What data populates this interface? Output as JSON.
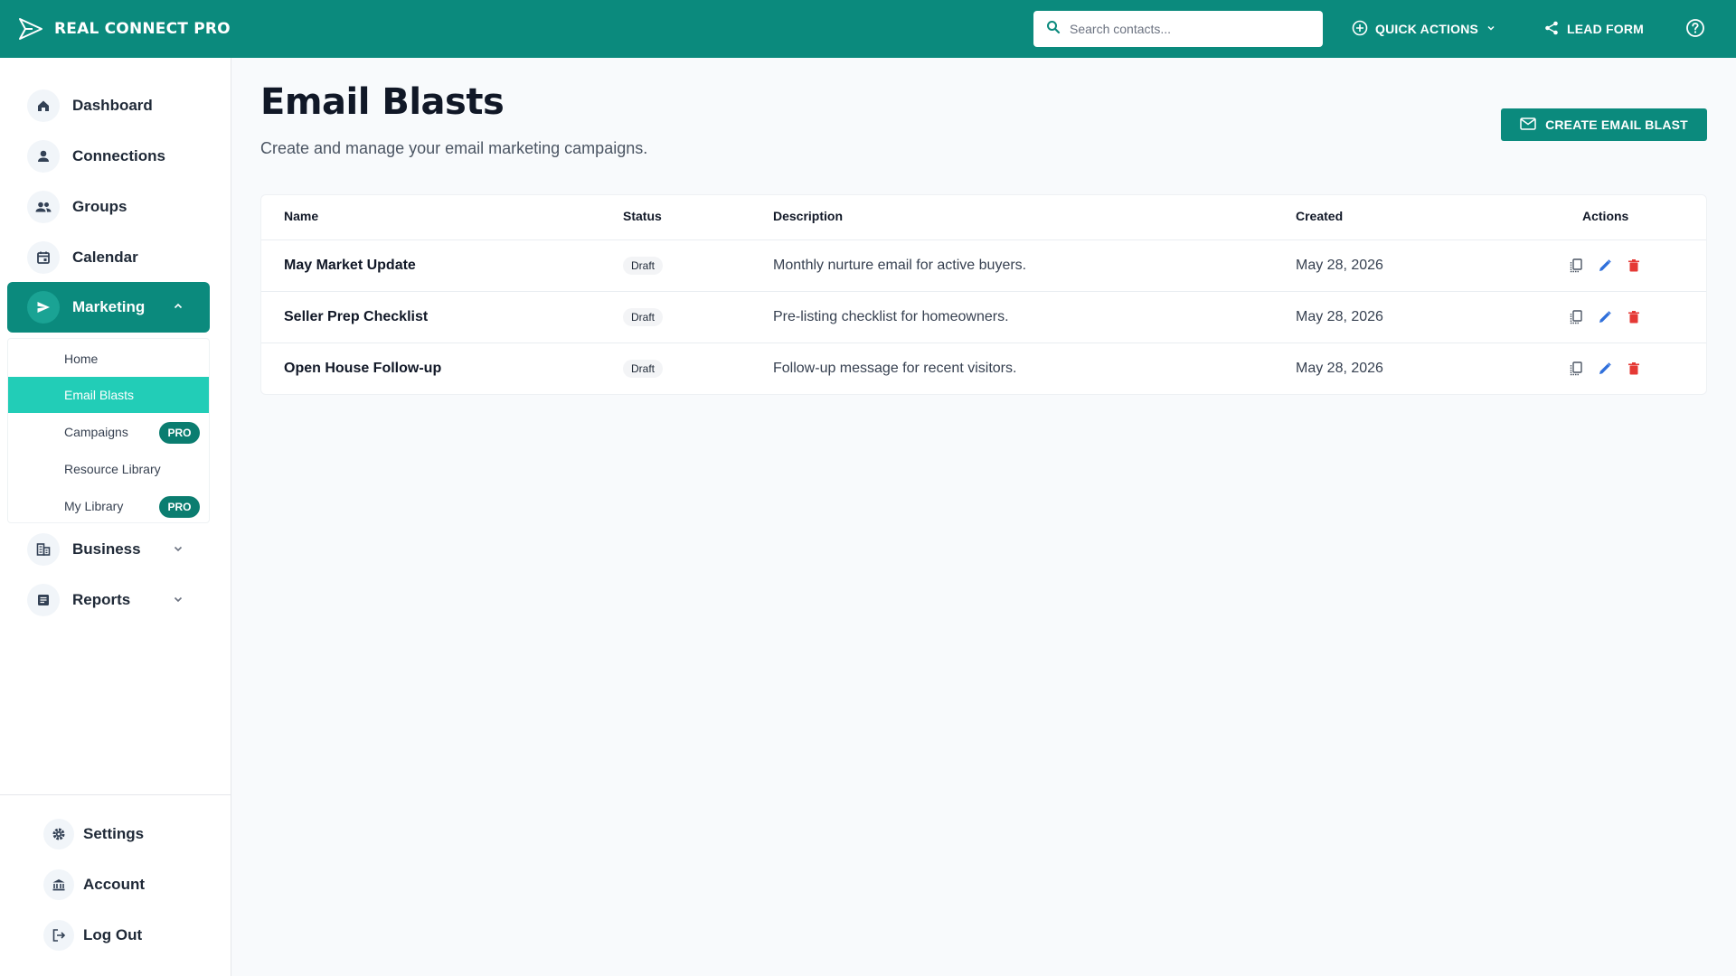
{
  "header": {
    "app_name": "REAL CONNECT PRO",
    "search_placeholder": "Search contacts...",
    "quick_actions_label": "QUICK ACTIONS",
    "lead_form_label": "LEAD FORM",
    "brand_color": "#0b8a7d"
  },
  "sidebar": {
    "items": [
      {
        "label": "Dashboard",
        "icon": "home-icon"
      },
      {
        "label": "Connections",
        "icon": "person-icon"
      },
      {
        "label": "Groups",
        "icon": "people-icon"
      },
      {
        "label": "Calendar",
        "icon": "calendar-icon"
      },
      {
        "label": "Marketing",
        "icon": "send-icon",
        "active": true,
        "expanded": true
      },
      {
        "label": "Business",
        "icon": "business-icon"
      },
      {
        "label": "Reports",
        "icon": "report-icon"
      }
    ],
    "marketing_sub": [
      {
        "label": "Home"
      },
      {
        "label": "Email Blasts",
        "active": true
      },
      {
        "label": "Campaigns",
        "badge": "PRO"
      },
      {
        "label": "Resource Library"
      },
      {
        "label": "My Library",
        "badge": "PRO"
      }
    ],
    "footer": [
      {
        "label": "Settings",
        "icon": "gear-icon"
      },
      {
        "label": "Account",
        "icon": "bank-icon"
      },
      {
        "label": "Log Out",
        "icon": "logout-icon"
      }
    ]
  },
  "main": {
    "title": "Email Blasts",
    "subtitle": "Create and manage your email marketing campaigns.",
    "create_label": "CREATE EMAIL BLAST",
    "table": {
      "columns": [
        "Name",
        "Status",
        "Description",
        "Created",
        "Actions"
      ],
      "rows": [
        {
          "name": "May Market Update",
          "status": "Draft",
          "description": "Monthly nurture email for active buyers.",
          "created": "May 28, 2026"
        },
        {
          "name": "Seller Prep Checklist",
          "status": "Draft",
          "description": "Pre-listing checklist for homeowners.",
          "created": "May 28, 2026"
        },
        {
          "name": "Open House Follow-up",
          "status": "Draft",
          "description": "Follow-up message for recent visitors.",
          "created": "May 28, 2026"
        }
      ]
    }
  },
  "colors": {
    "accent": "#0b8a7d",
    "sub_active": "#22cdb7",
    "edit": "#2f6fdb",
    "delete": "#e53935"
  }
}
